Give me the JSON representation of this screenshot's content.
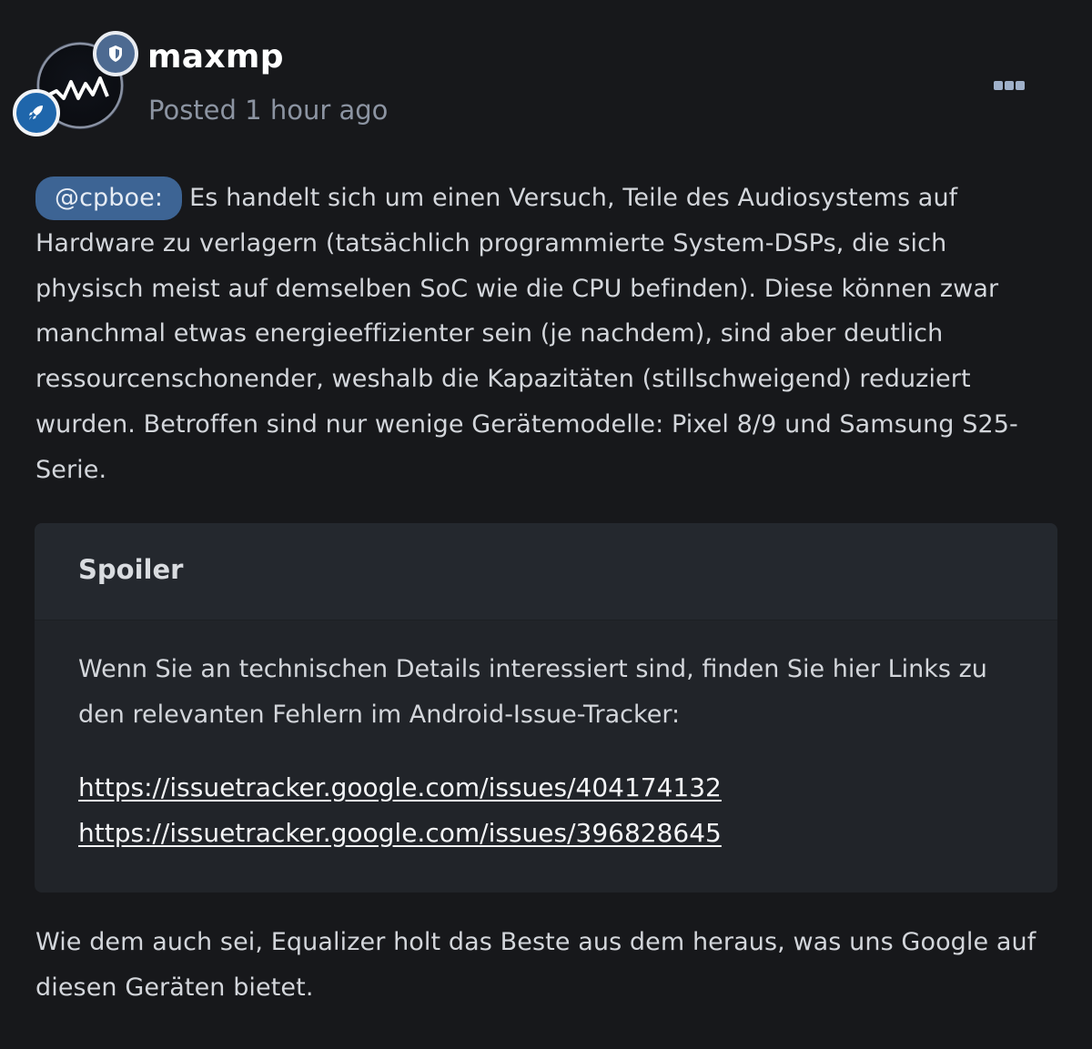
{
  "post": {
    "author": "maxmp",
    "posted_prefix": "Posted ",
    "posted_time": "1 hour ago",
    "avatar_icon": "waveform-avatar-icon",
    "mod_badge_icon": "shield-icon",
    "rank_badge_icon": "rocket-icon",
    "more_icon": "more-options-icon",
    "colors": {
      "background": "#17181b",
      "mention_bg": "#3d6494",
      "mod_badge": "#4d6a91",
      "rank_badge": "#1f66ab",
      "spoiler_bg": "#212429"
    }
  },
  "body": {
    "mention": "@cpboe:",
    "paragraph1": "Es handelt sich um einen Versuch, Teile des Audiosystems auf Hardware zu verlagern (tatsächlich programmierte System-DSPs, die sich physisch meist auf demselben SoC wie die CPU befinden). Diese können zwar manchmal etwas energieeffizienter sein (je nachdem), sind aber deutlich ressourcenschonender, weshalb die Kapazitäten (stillschweigend) reduziert wurden. Betroffen sind nur wenige Gerätemodelle: Pixel 8/9 und Samsung S25-Serie.",
    "closing": "Wie dem auch sei, Equalizer holt das Beste aus dem heraus, was uns Google auf diesen Geräten bietet."
  },
  "spoiler": {
    "title": "Spoiler",
    "text": "Wenn Sie an technischen Details interessiert sind, finden Sie hier Links zu den relevanten Fehlern im Android-Issue-Tracker:",
    "links": [
      "https://issuetracker.google.com/issues/404174132",
      "https://issuetracker.google.com/issues/396828645"
    ]
  }
}
